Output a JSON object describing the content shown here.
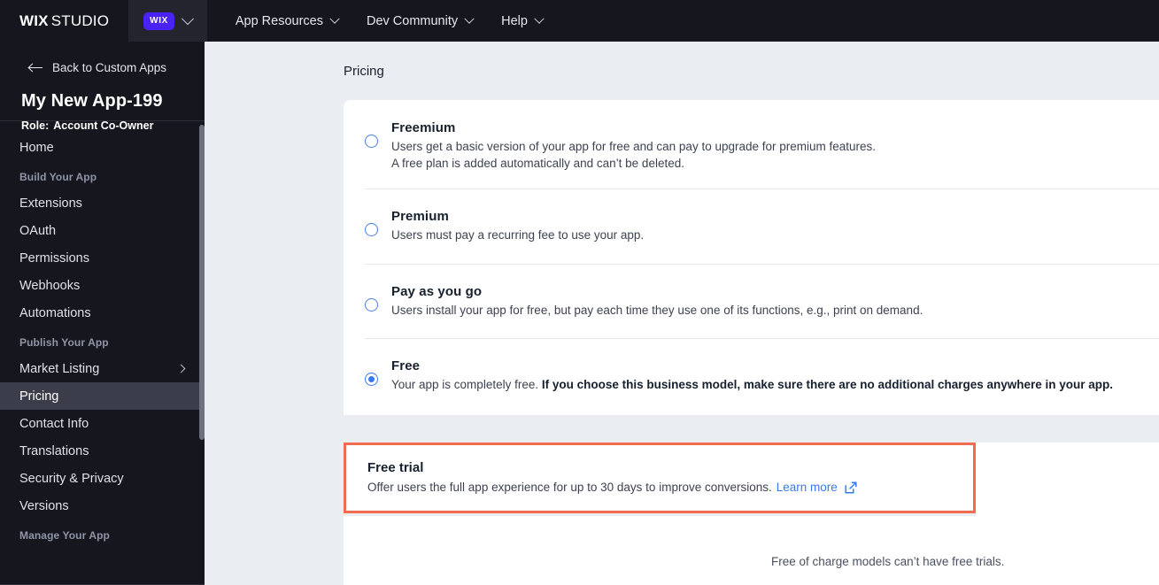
{
  "topbar": {
    "brand_bold": "WIX",
    "brand_light": "STUDIO",
    "wix_badge": "WIX",
    "nav": [
      {
        "label": "App Resources",
        "icon": "chevron-down-icon"
      },
      {
        "label": "Dev Community",
        "icon": "chevron-down-icon"
      },
      {
        "label": "Help",
        "icon": "chevron-down-icon"
      }
    ]
  },
  "sidebar": {
    "back_label": "Back to Custom Apps",
    "app_name": "My New App-199",
    "role_key": "Role:",
    "role_value": "Account Co-Owner",
    "items": [
      {
        "label": "Home",
        "type": "item",
        "active": false
      },
      {
        "label": "Build Your App",
        "type": "group"
      },
      {
        "label": "Extensions",
        "type": "item",
        "active": false
      },
      {
        "label": "OAuth",
        "type": "item",
        "active": false
      },
      {
        "label": "Permissions",
        "type": "item",
        "active": false
      },
      {
        "label": "Webhooks",
        "type": "item",
        "active": false
      },
      {
        "label": "Automations",
        "type": "item",
        "active": false
      },
      {
        "label": "Publish Your App",
        "type": "group"
      },
      {
        "label": "Market Listing",
        "type": "item",
        "active": false,
        "chevron": true
      },
      {
        "label": "Pricing",
        "type": "item",
        "active": true
      },
      {
        "label": "Contact Info",
        "type": "item",
        "active": false
      },
      {
        "label": "Translations",
        "type": "item",
        "active": false
      },
      {
        "label": "Security & Privacy",
        "type": "item",
        "active": false
      },
      {
        "label": "Versions",
        "type": "item",
        "active": false
      },
      {
        "label": "Manage Your App",
        "type": "group"
      }
    ]
  },
  "main": {
    "page_title": "Pricing",
    "business_models": [
      {
        "id": "freemium",
        "title": "Freemium",
        "desc_line1": "Users get a basic version of your app for free and can pay to upgrade for premium features.",
        "desc_line2": "A free plan is added automatically and can’t be deleted.",
        "selected": false
      },
      {
        "id": "premium",
        "title": "Premium",
        "desc_line1": "Users must pay a recurring fee to use your app.",
        "desc_line2": "",
        "selected": false
      },
      {
        "id": "pay-as-you-go",
        "title": "Pay as you go",
        "desc_line1": "Users install your app for free, but pay each time they use one of its functions, e.g., print on demand.",
        "desc_line2": "",
        "selected": false
      },
      {
        "id": "free",
        "title": "Free",
        "desc_plain": "Your app is completely free. ",
        "desc_bold": "If you choose this business model, make sure there are no additional charges anywhere in your app.",
        "selected": true
      }
    ],
    "free_trial": {
      "title": "Free trial",
      "description": "Offer users the full app experience for up to 30 days to improve conversions.",
      "link_label": "Learn more",
      "link_icon": "external-link-icon",
      "highlight_color": "#f26a50"
    },
    "note": "Free of charge models can’t have free trials."
  },
  "colors": {
    "topbar_bg": "#16161e",
    "sidebar_bg": "#16161e",
    "sidebar_active": "#3b3d4a",
    "content_bg": "#eaedf1",
    "accent_blue": "#3979f0",
    "wix_purple": "#4b22f4",
    "highlight_orange": "#f26a50"
  }
}
